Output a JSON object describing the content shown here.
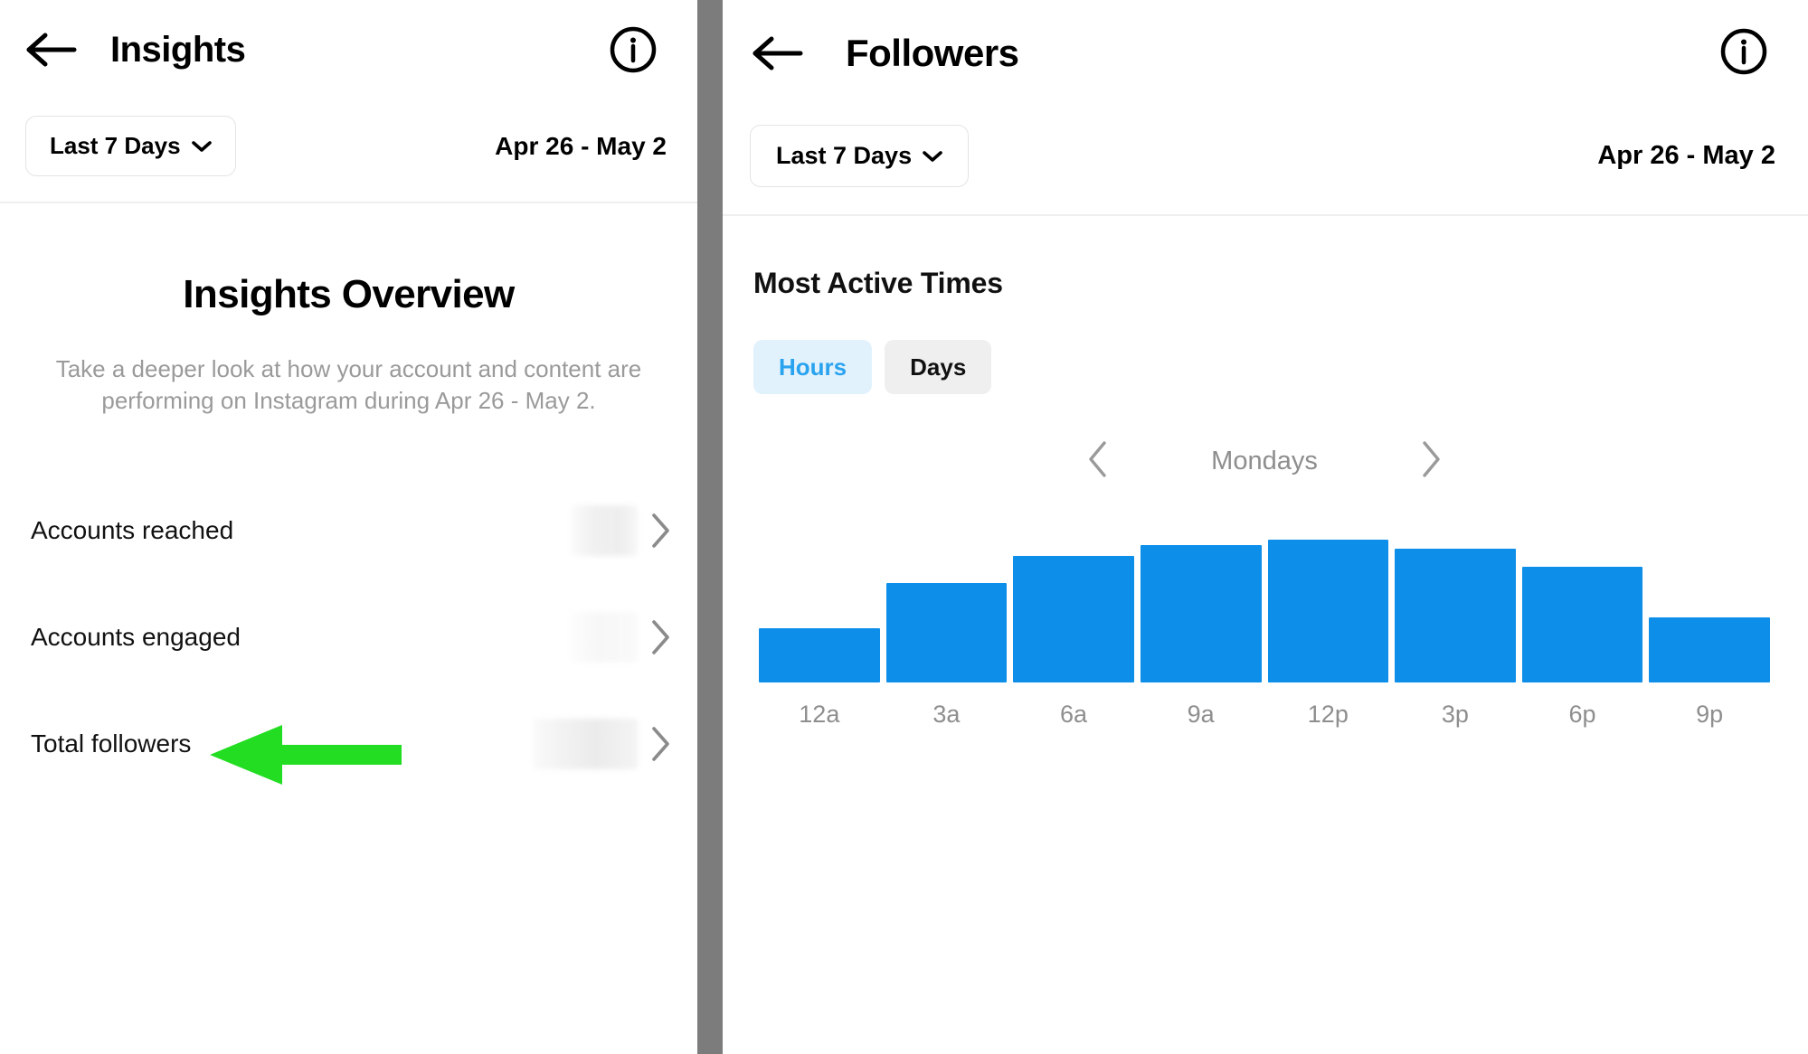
{
  "left_panel": {
    "nav": {
      "back_icon": "back-arrow-icon",
      "title": "Insights",
      "info_icon": "info-circle-icon"
    },
    "date_bar": {
      "range_label": "Last 7 Days",
      "chevron_icon": "chevron-down-icon",
      "date_range": "Apr 26 - May 2"
    },
    "overview": {
      "title": "Insights Overview",
      "description": "Take a deeper look at how your account and content are performing on Instagram during Apr 26 - May 2."
    },
    "metrics": [
      {
        "label": "Accounts reached",
        "value": "",
        "value_style": "blur-medium",
        "chevron_icon": "chevron-right-icon"
      },
      {
        "label": "Accounts engaged",
        "value": "",
        "value_style": "blur-faint",
        "chevron_icon": "chevron-right-icon"
      },
      {
        "label": "Total followers",
        "value": "",
        "value_style": "blur-wide",
        "chevron_icon": "chevron-right-icon"
      }
    ],
    "annotation": {
      "type": "green-left-arrow",
      "color": "#22dd22",
      "points_at": "Total followers"
    }
  },
  "right_panel": {
    "nav": {
      "back_icon": "back-arrow-icon",
      "title": "Followers",
      "info_icon": "info-circle-icon"
    },
    "date_bar": {
      "range_label": "Last 7 Days",
      "chevron_icon": "chevron-down-icon",
      "date_range": "Apr 26 - May 2"
    },
    "most_active_times": {
      "title": "Most Active Times",
      "segments": [
        {
          "label": "Hours",
          "selected": true
        },
        {
          "label": "Days",
          "selected": false
        }
      ],
      "day_nav": {
        "prev_icon": "chevron-left-icon",
        "label": "Mondays",
        "next_icon": "chevron-right-icon"
      }
    }
  },
  "colors": {
    "bar_blue": "#0d8ee8",
    "segment_active_bg": "#e2f2fd",
    "segment_active_text": "#2aa3ef",
    "segment_inactive_bg": "#efefef",
    "muted_text": "#8e8e8e",
    "annotation_green": "#22dd22",
    "divider_gray": "#7c7c7c"
  },
  "chart_data": {
    "type": "bar",
    "title": "Most Active Times",
    "subtitle": "Mondays",
    "categories": [
      "12a",
      "3a",
      "6a",
      "9a",
      "12p",
      "3p",
      "6p",
      "9p"
    ],
    "values": [
      60,
      110,
      140,
      152,
      158,
      148,
      128,
      72
    ],
    "xlabel": "",
    "ylabel": "",
    "ylim": [
      0,
      176
    ],
    "grid": false,
    "legend": "none",
    "series_color": "#0d8ee8"
  }
}
